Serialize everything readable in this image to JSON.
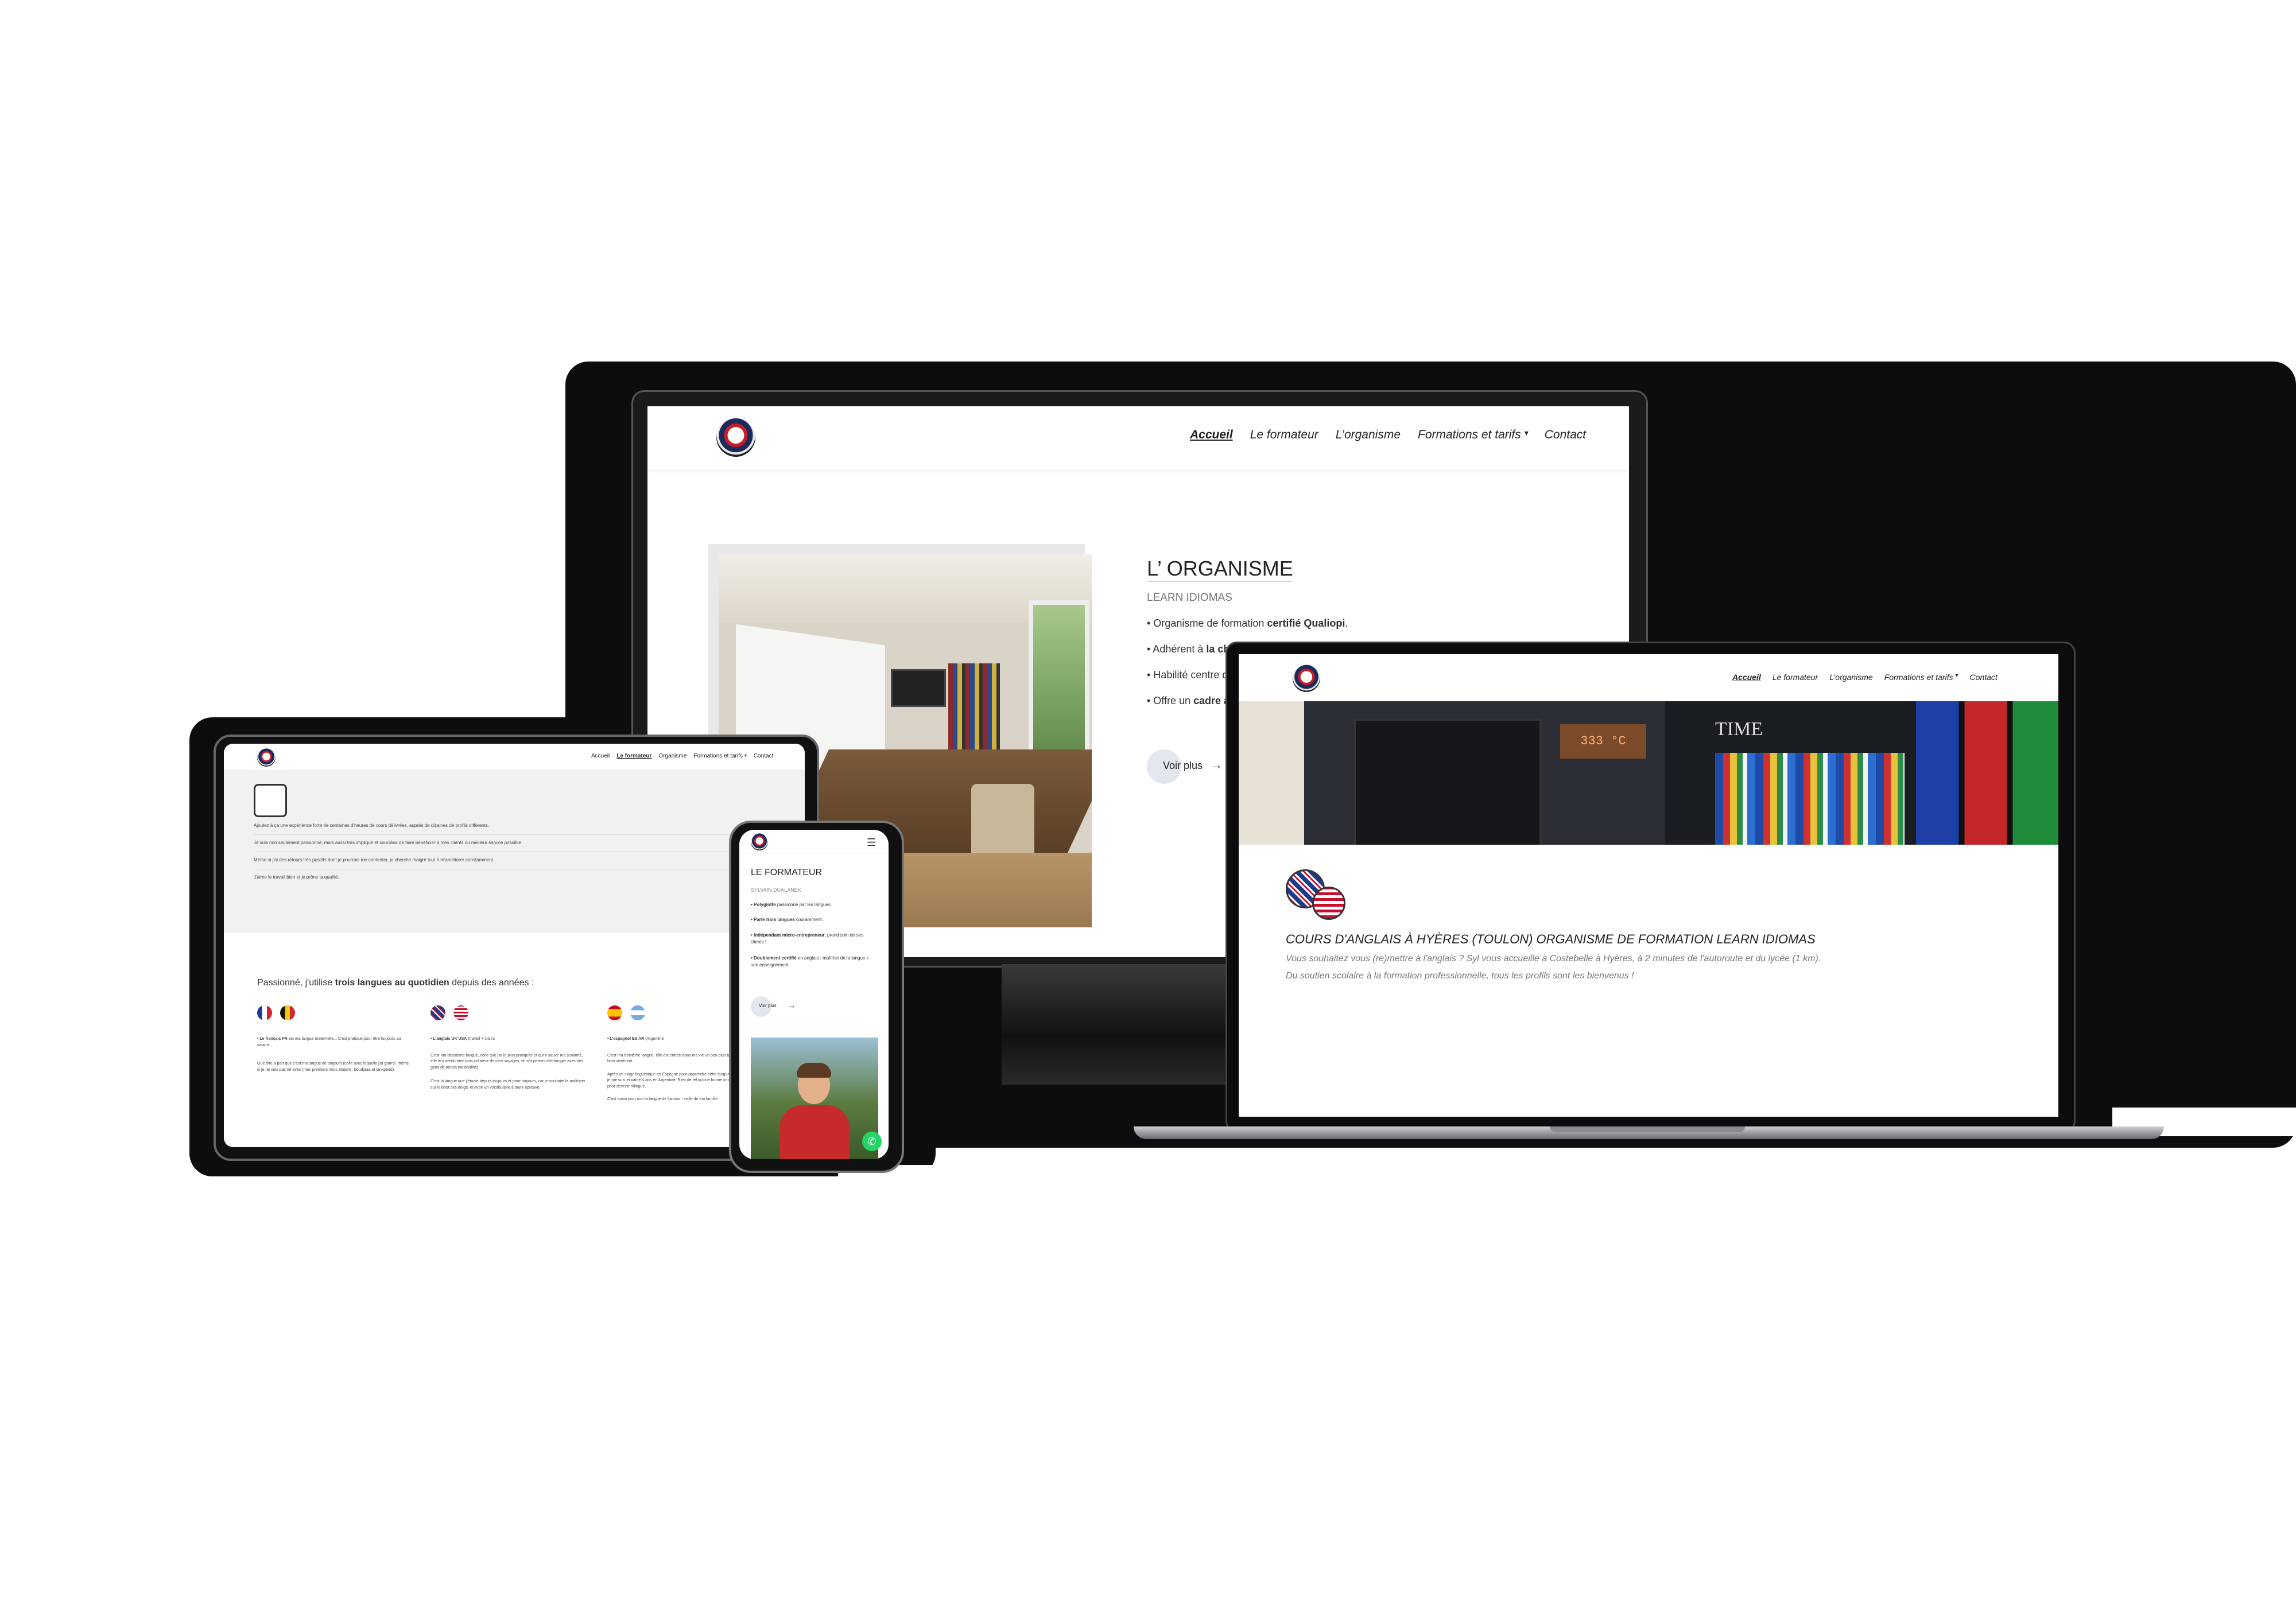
{
  "desktop": {
    "nav": {
      "items": [
        "Accueil",
        "Le formateur",
        "L’organisme",
        "Formations et tarifs",
        "Contact"
      ],
      "active": "Accueil"
    },
    "section_title": "L’ ORGANISME",
    "subtitle": "LEARN IDIOMAS",
    "bullets": [
      {
        "pre": "• Organisme de formation ",
        "bold": "certifié Qualiopi",
        "post": "."
      },
      {
        "pre": "• Adhérent à ",
        "bold": "la cha",
        "post": ""
      },
      {
        "pre": "• Habilité centre d",
        "bold": "",
        "post": ""
      },
      {
        "pre": "• Offre un ",
        "bold": "cadre a",
        "post": ""
      }
    ],
    "cta": "Voir plus"
  },
  "laptop": {
    "nav": {
      "items": [
        "Accueil",
        "Le formateur",
        "L’organisme",
        "Formations et tarifs",
        "Contact"
      ],
      "active": "Accueil"
    },
    "hero_clock": "333 °C",
    "hero_book": "TIME",
    "headline": "COURS D'ANGLAIS À HYÈRES (TOULON) ORGANISME DE FORMATION LEARN IDIOMAS",
    "intro_line1": "Vous souhaitez vous (re)mettre à l'anglais ? Syl vous accueille à Costebelle à Hyères, à 2 minutes de l'autoroute et du lycée (1 km).",
    "intro_line2": "Du soutien scolaire à la formation professionnelle, tous les profils sont les bienvenus !"
  },
  "tablet": {
    "nav": {
      "items": [
        "Accueil",
        "Le formateur",
        "Organisme",
        "Formations et tarifs",
        "Contact"
      ],
      "active": "Le formateur"
    },
    "lines": [
      "Ajoutez à ça une expérience forte de centaines d'heures de cours délivrées, auprès de dizaines de profils différents.",
      "Je suis non seulement passionné, mais aussi très impliqué et soucieux de faire bénéficier à mes clients du meilleur service possible.",
      "Même si j'ai des retours très positifs dont je pourrais me contenter, je cherche malgré tout à m'améliorer constamment.",
      "J'aime le travail bien et je prône la qualité."
    ],
    "passion": {
      "pre": "Passionné, j'utilise ",
      "bold": "trois langues au quotidien",
      "post": " depuis des années :"
    },
    "columns": [
      {
        "head": "• Le français FR",
        "head_rest": " est ma langue maternelle... C'est pratique pour être toujours au salaire.",
        "body": "Que dire à part que c'est ma langue de toujours (celle avec laquelle j'ai grandi, même si je ne suis pas né avec (mes premiers mots étaient : boudjaaa et lankpeed)."
      },
      {
        "head": "• L'anglais UK USA",
        "head_rest": " (travail + loisirs",
        "body": "C'est ma deuxième langue, celle que j'ai le plus pratiquée et qui a sauvé ma scolarité, elle m'a rendu bien plus créateur de mes voyages, et m'a permis d'échanger avec des gens de toutes nationalités.",
        "body2": "C'est la langue que j'étudie depuis toujours et pour toujours, car je souhaite la maîtriser sur le bout des doigts et avoir un vocabulaire à toute épreuve."
      },
      {
        "head": "• L'espagnol ES AR",
        "head_rest": " (Argentine",
        "body": "C'est ma troisième langue, elle est entrée dans ma vie un peu plus tard mais bien vivement.",
        "body2": "Après un stage linguistique en Espagne pour apprendre cette langue (un an), je me suis expatrié 4 ans en Argentine. Rien de tel qu'une bonne immersion pour devenir trilingue.",
        "body3": "C'est aussi pour moi la langue de l'amour - celle de ma famille."
      }
    ]
  },
  "phone": {
    "title": "LE FORMATEUR",
    "name": "SYLVAIN DUALANEK",
    "bullets": [
      {
        "bold": "• Polyglotte",
        "rest": " passionné par les langues."
      },
      {
        "bold": "• Parle trois langues",
        "rest": " couramment."
      },
      {
        "bold": "• Indépendant micro-entrepreneur",
        "rest": ", prend soin de ses clients !"
      },
      {
        "bold": "• Doublement certifié",
        "rest": " en anglais : maîtrise de la langue + son enseignement."
      }
    ],
    "cta": "Voir plus"
  }
}
